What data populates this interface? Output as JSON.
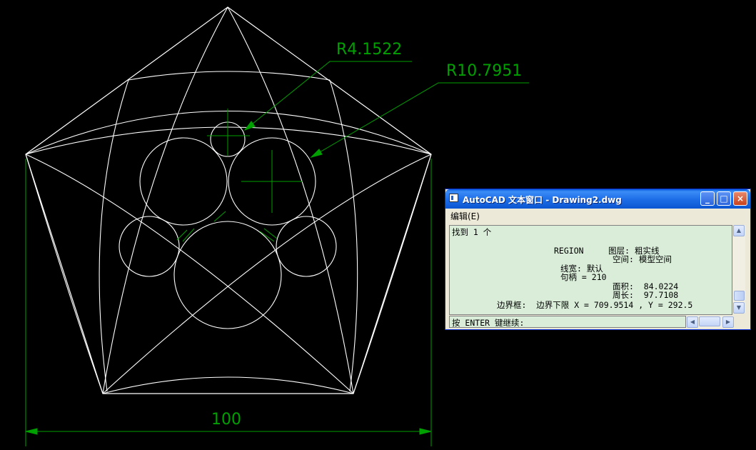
{
  "drawing": {
    "dimension_radius_small": "R4.1522",
    "dimension_radius_large": "R10.7951",
    "dimension_width": "100"
  },
  "text_window": {
    "title": "AutoCAD 文本窗口 - Drawing2.dwg",
    "menu_edit": "编辑(E)",
    "minimize_label": "_",
    "maximize_label": "□",
    "close_label": "×",
    "lines": [
      "找到 1 个",
      "REGION     图层: 粗实线",
      "空间: 模型空间",
      "线宽: 默认",
      "句柄 = 210",
      "面积:  84.0224",
      "周长:  97.7108",
      "边界框:  边界下限 X = 709.9514 , Y = 292.5"
    ],
    "prompt": "按 ENTER 键继续:"
  },
  "colors": {
    "background": "#000000",
    "geometry": "#ffffff",
    "dimension": "#00a000",
    "output_bg": "#d9edd9"
  }
}
